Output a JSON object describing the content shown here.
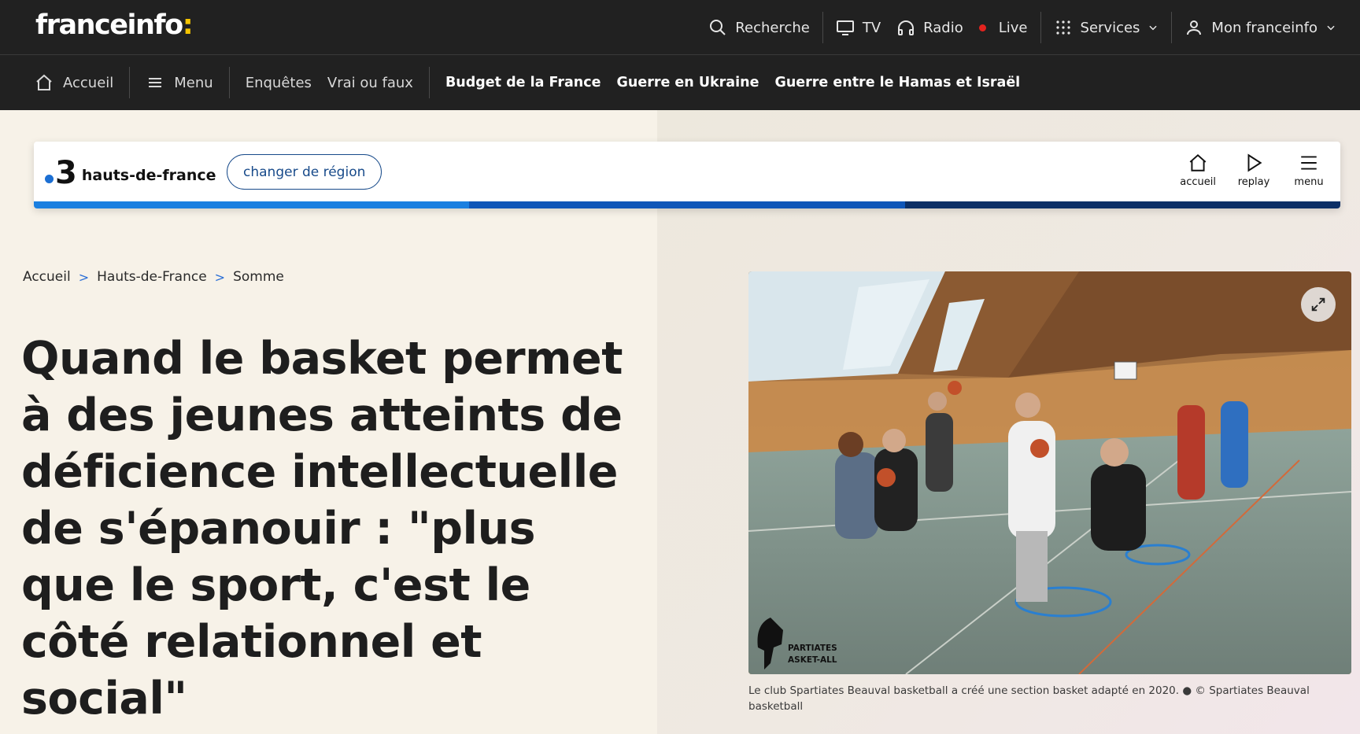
{
  "brand": {
    "name": "franceinfo",
    "colon": ":"
  },
  "topbar": {
    "search": "Recherche",
    "tv": "TV",
    "radio": "Radio",
    "live": "Live",
    "services": "Services",
    "account": "Mon franceinfo"
  },
  "nav": {
    "home": "Accueil",
    "menu": "Menu",
    "items": [
      "Enquêtes",
      "Vrai ou faux"
    ],
    "highlights": [
      "Budget de la France",
      "Guerre en Ukraine",
      "Guerre entre le Hamas et Israël"
    ]
  },
  "region": {
    "channel_number": "3",
    "name": "hauts-de-france",
    "change_label": "changer de région",
    "actions": {
      "home": "accueil",
      "replay": "replay",
      "menu": "menu"
    }
  },
  "breadcrumb": [
    "Accueil",
    "Hauts-de-France",
    "Somme"
  ],
  "article": {
    "headline": "Quand le basket permet à des jeunes atteints de déficience intellectuelle de s'épanouir : \"plus que le sport, c'est le côté relationnel et social\"",
    "caption": "Le club Spartiates Beauval basketball a créé une section basket adapté en 2020. ● © Spartiates Beauval basketball",
    "watermark_line1": "PARTIATES",
    "watermark_line2": "ASKET-ALL"
  },
  "colors": {
    "topbar_bg": "#212121",
    "page_bg": "#f7f2e8",
    "accent_yellow": "#f5c400",
    "live_red": "#e4231e",
    "region_blue": "#174a8a",
    "stripe": [
      "#1a7fe0",
      "#0f56b8",
      "#0c2f66"
    ]
  }
}
